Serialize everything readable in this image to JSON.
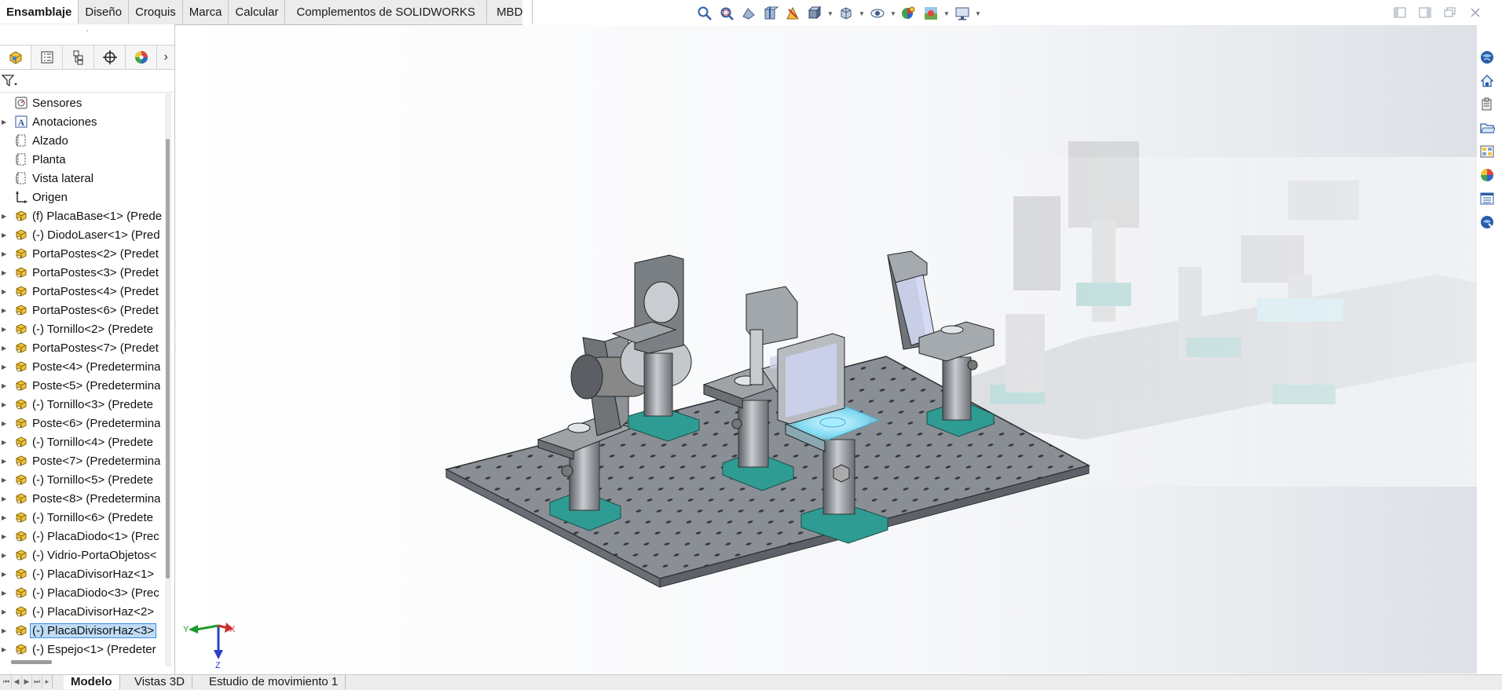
{
  "command_tabs": [
    "Ensamblaje",
    "Diseño",
    "Croquis",
    "Marca",
    "Calcular",
    "Complementos de SOLIDWORKS",
    "MBD"
  ],
  "active_command_tab": "Ensamblaje",
  "hud_icons": [
    "zoom-to-fit-icon",
    "zoom-to-area-icon",
    "previous-view-icon",
    "section-view-icon",
    "dynamic-annotation-icon",
    "view-orientation-icon",
    "display-style-icon",
    "hide-show-icon",
    "edit-appearance-icon",
    "apply-scene-icon",
    "view-settings-icon"
  ],
  "feature_manager_tabs": [
    "featuremanager-icon",
    "propertymanager-icon",
    "configurationmanager-icon",
    "dimxpertmanager-icon",
    "displaymanager-icon"
  ],
  "tree": [
    {
      "label": "Sensores",
      "icon": "sensor-icon",
      "expandable": false
    },
    {
      "label": "Anotaciones",
      "icon": "annotation-icon",
      "expandable": true
    },
    {
      "label": "Alzado",
      "icon": "plane-icon",
      "expandable": false
    },
    {
      "label": "Planta",
      "icon": "plane-icon",
      "expandable": false
    },
    {
      "label": "Vista lateral",
      "icon": "plane-icon",
      "expandable": false
    },
    {
      "label": "Origen",
      "icon": "origin-icon",
      "expandable": false
    },
    {
      "label": "(f) PlacaBase<1> (Prede",
      "icon": "part-icon",
      "expandable": true
    },
    {
      "label": "(-) DiodoLaser<1> (Pred",
      "icon": "part-icon",
      "expandable": true
    },
    {
      "label": "PortaPostes<2> (Predet",
      "icon": "part-icon",
      "expandable": true
    },
    {
      "label": "PortaPostes<3> (Predet",
      "icon": "part-icon",
      "expandable": true
    },
    {
      "label": "PortaPostes<4> (Predet",
      "icon": "part-icon",
      "expandable": true
    },
    {
      "label": "PortaPostes<6> (Predet",
      "icon": "part-icon",
      "expandable": true
    },
    {
      "label": "(-) Tornillo<2> (Predete",
      "icon": "part-icon",
      "expandable": true
    },
    {
      "label": "PortaPostes<7> (Predet",
      "icon": "part-icon",
      "expandable": true
    },
    {
      "label": "Poste<4> (Predetermina",
      "icon": "part-icon",
      "expandable": true
    },
    {
      "label": "Poste<5> (Predetermina",
      "icon": "part-icon",
      "expandable": true
    },
    {
      "label": "(-) Tornillo<3> (Predete",
      "icon": "part-icon",
      "expandable": true
    },
    {
      "label": "Poste<6> (Predetermina",
      "icon": "part-icon",
      "expandable": true
    },
    {
      "label": "(-) Tornillo<4> (Predete",
      "icon": "part-icon",
      "expandable": true
    },
    {
      "label": "Poste<7> (Predetermina",
      "icon": "part-icon",
      "expandable": true
    },
    {
      "label": "(-) Tornillo<5> (Predete",
      "icon": "part-icon",
      "expandable": true
    },
    {
      "label": "Poste<8> (Predetermina",
      "icon": "part-icon",
      "expandable": true
    },
    {
      "label": "(-) Tornillo<6> (Predete",
      "icon": "part-icon",
      "expandable": true
    },
    {
      "label": "(-) PlacaDiodo<1> (Prec",
      "icon": "part-icon",
      "expandable": true
    },
    {
      "label": "(-) Vidrio-PortaObjetos<",
      "icon": "part-icon",
      "expandable": true
    },
    {
      "label": "(-) PlacaDivisorHaz<1>",
      "icon": "part-icon",
      "expandable": true
    },
    {
      "label": "(-) PlacaDiodo<3> (Prec",
      "icon": "part-icon",
      "expandable": true
    },
    {
      "label": "(-) PlacaDivisorHaz<2>",
      "icon": "part-icon",
      "expandable": true
    },
    {
      "label": "(-) PlacaDivisorHaz<3>",
      "icon": "part-icon",
      "expandable": true,
      "selected": true
    },
    {
      "label": "(-) Espejo<1> (Predeter",
      "icon": "part-icon",
      "expandable": true
    }
  ],
  "bottom_tabs": [
    "Modelo",
    "Vistas 3D",
    "Estudio de movimiento 1"
  ],
  "active_bottom_tab": "Modelo",
  "task_pane_icons": [
    "solidworks-resources-icon",
    "design-library-icon",
    "file-explorer-icon",
    "open-folder-icon",
    "view-palette-icon",
    "appearances-icon",
    "custom-properties-icon",
    "forum-icon"
  ],
  "triad_labels": {
    "x": "X",
    "y": "Y",
    "z": "Z"
  },
  "colors": {
    "selection": "#bfdcf6",
    "plate": "#8a8f96",
    "base": "#2f9c93",
    "highlight": "#a8ecff"
  }
}
